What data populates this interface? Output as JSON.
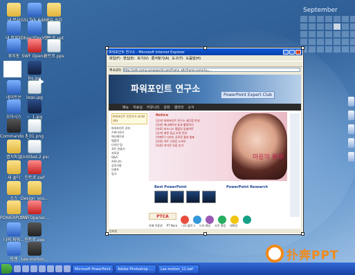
{
  "desktop_icons": [
    {
      "label": "내 문서",
      "glyph": "g-folder"
    },
    {
      "label": "GSI Tab Address",
      "glyph": "g-blue"
    },
    {
      "label": "공유 폴더",
      "glyph": "g-folder"
    },
    {
      "label": "내 컴퓨터",
      "glyph": "g-blue"
    },
    {
      "label": "ObjectDock Plus 1.5",
      "glyph": "g-blue"
    },
    {
      "label": "인트로.ppt",
      "glyph": "g-doc"
    },
    {
      "label": "휴지통",
      "glyph": "g-blue"
    },
    {
      "label": "SWF Opener",
      "glyph": "g-red"
    },
    {
      "label": "인트로.pps",
      "glyph": "g-doc"
    },
    {
      "label": "bg.jpg",
      "glyph": "g-img"
    },
    {
      "label": "네이트온",
      "glyph": "g-blue"
    },
    {
      "label": "logo.jpg",
      "glyph": "g-doc"
    },
    {
      "label": "오아시스",
      "glyph": "g-blue"
    },
    {
      "label": "~_1.jpg",
      "glyph": "g-img"
    },
    {
      "label": "Commando 3",
      "glyph": "g-dark"
    },
    {
      "label": "f_01.png",
      "glyph": "g-doc"
    },
    {
      "label": "캡처파일",
      "glyph": "g-folder"
    },
    {
      "label": "Untitled-2.psd",
      "glyph": "g-doc"
    },
    {
      "label": "새 폴더",
      "glyph": "g-folder"
    },
    {
      "label": "인트로.swf",
      "glyph": "g-red"
    },
    {
      "label": "소스",
      "glyph": "g-folder"
    },
    {
      "label": "Design_sou...",
      "glyph": "g-folder"
    },
    {
      "label": "POWERPOINT",
      "glyph": "g-folder"
    },
    {
      "label": "SWFOpener...",
      "glyph": "g-red"
    },
    {
      "label": "나의 파워...",
      "glyph": "g-blue"
    },
    {
      "label": "인트로.exe",
      "glyph": "g-dark"
    },
    {
      "label": "토렌",
      "glyph": "g-blue"
    },
    {
      "label": "Lex-motion...",
      "glyph": "g-dark"
    }
  ],
  "calendar": {
    "month": "September",
    "today_index": 11
  },
  "browser": {
    "title": "파워포인트 연구소 - Microsoft Internet Explorer",
    "menu": [
      "파일(F)",
      "편집(E)",
      "보기(V)",
      "즐겨찾기(A)",
      "도구(T)",
      "도움말(H)"
    ],
    "address_label": "주소(D)",
    "address_url": "http://safe.nemo.sengsworld.com/frame_attr/frame.nemo?p=...",
    "status": "인터넷"
  },
  "site": {
    "logo": "파워포인트 연구소",
    "banner": "PowerPoint Expert Club",
    "nav": [
      "메뉴",
      "자료실",
      "커뮤니티",
      "강좌",
      "갤러리",
      "소식"
    ],
    "promo": "파워포인트 전문가가 되어보세요",
    "side_items": [
      "파워포인트 강좌",
      "기초다지기",
      "애니메이션",
      "템플릿",
      "디자인 팁",
      "차트 만들기",
      "자료실",
      "Q&A",
      "커뮤니티",
      "공지사항",
      "이벤트",
      "링크"
    ],
    "notice_tag": "Notice",
    "news_items": [
      "[공지] 파워포인트 연구소 새단장 안내",
      "[강좌] 애니메이션 효과 활용하기",
      "[자료] 비즈니스 템플릿 업데이트",
      "[공지] 회원 등급 조정 안내",
      "[이벤트] 디자인 공모전 결과 발표",
      "[강좌] 차트 디자인 노하우",
      "[자료] 아이콘 모음 추가"
    ],
    "calligraphy": "마음의 美學",
    "section_best": "Best PowerPoint",
    "section_research": "PowerPoint Research",
    "ptca_label": "PTCA",
    "footer_links": [
      "카페 이용권",
      "PT Nara",
      "나의 블로그",
      "나의 메일",
      "사진 앨범",
      "대화방"
    ]
  },
  "taskbar": {
    "tasks": [
      "Microsoft PowerPoint...",
      "Adobe Photoshop -...",
      "Lex-motion_11.swf"
    ]
  },
  "watermark": {
    "text": "扑奔PPT"
  }
}
